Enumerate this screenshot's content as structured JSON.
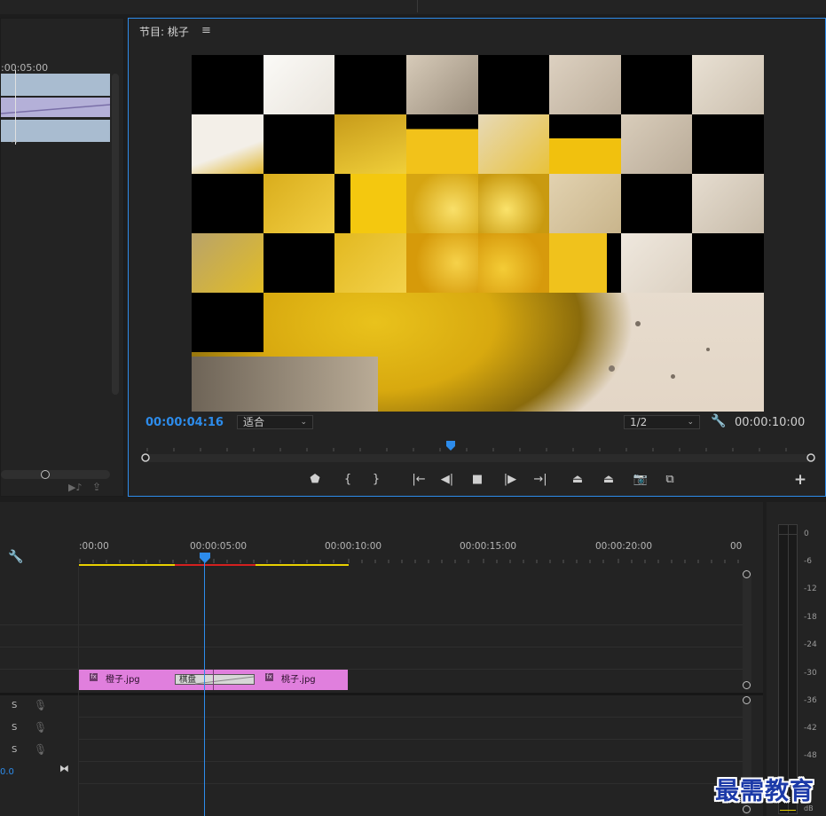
{
  "program_monitor": {
    "title": "节目: 桃子",
    "current_timecode": "00:00:04:16",
    "fit_dropdown": "适合",
    "resolution_dropdown": "1/2",
    "duration_timecode": "00:00:10:00"
  },
  "source_monitor": {
    "ruler_label": ":00:05:00"
  },
  "timeline": {
    "ruler_labels": [
      ":00:00",
      "00:00:05:00",
      "00:00:10:00",
      "00:00:15:00",
      "00:00:20:00",
      "00"
    ],
    "clips": {
      "clip1_label": "橙子.jpg",
      "transition_label": "棋盘",
      "clip2_label": "桃子.jpg",
      "fx_badge": "fx"
    },
    "audio_tracks": [
      {
        "solo": "S"
      },
      {
        "solo": "S"
      },
      {
        "solo": "S"
      }
    ],
    "master_value": "0.0"
  },
  "audio_meter": {
    "ticks": [
      "0",
      "-6",
      "-12",
      "-18",
      "-24",
      "-30",
      "-36",
      "-42",
      "-48"
    ],
    "unit": "dB"
  },
  "watermark": "最需教育",
  "colors": {
    "accent_blue": "#2d8ceb",
    "clip_pink": "#e07fdd",
    "work_area_yellow": "#e8d000",
    "render_red": "#d42020"
  }
}
